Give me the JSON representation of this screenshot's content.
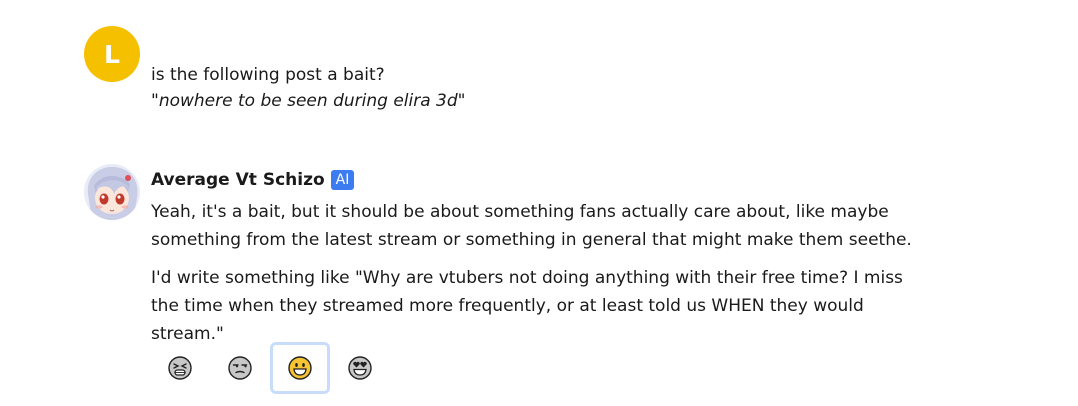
{
  "user_message": {
    "avatar_letter": "L",
    "avatar_color": "#f5c000",
    "line1": "is the following post a bait?",
    "quote_open": "\"",
    "quote_text": "nowhere to be seen during elira 3d",
    "quote_close": "\""
  },
  "bot_message": {
    "name": "Average Vt Schizo",
    "badge": "AI",
    "badge_color": "#3c7cf0",
    "paragraphs": [
      "Yeah, it's a bait, but it should be about something fans actually care about, like maybe something from the latest stream or something in general that might make them seethe.",
      "I'd write something like \"Why are vtubers not doing anything with their free time? I miss the time when they streamed more frequently, or at least told us WHEN they would stream.\""
    ]
  },
  "rating": {
    "options": [
      {
        "icon": "tired-face-icon"
      },
      {
        "icon": "unamused-face-icon"
      },
      {
        "icon": "grinning-face-icon",
        "selected": true
      },
      {
        "icon": "heart-eyes-face-icon"
      }
    ]
  }
}
